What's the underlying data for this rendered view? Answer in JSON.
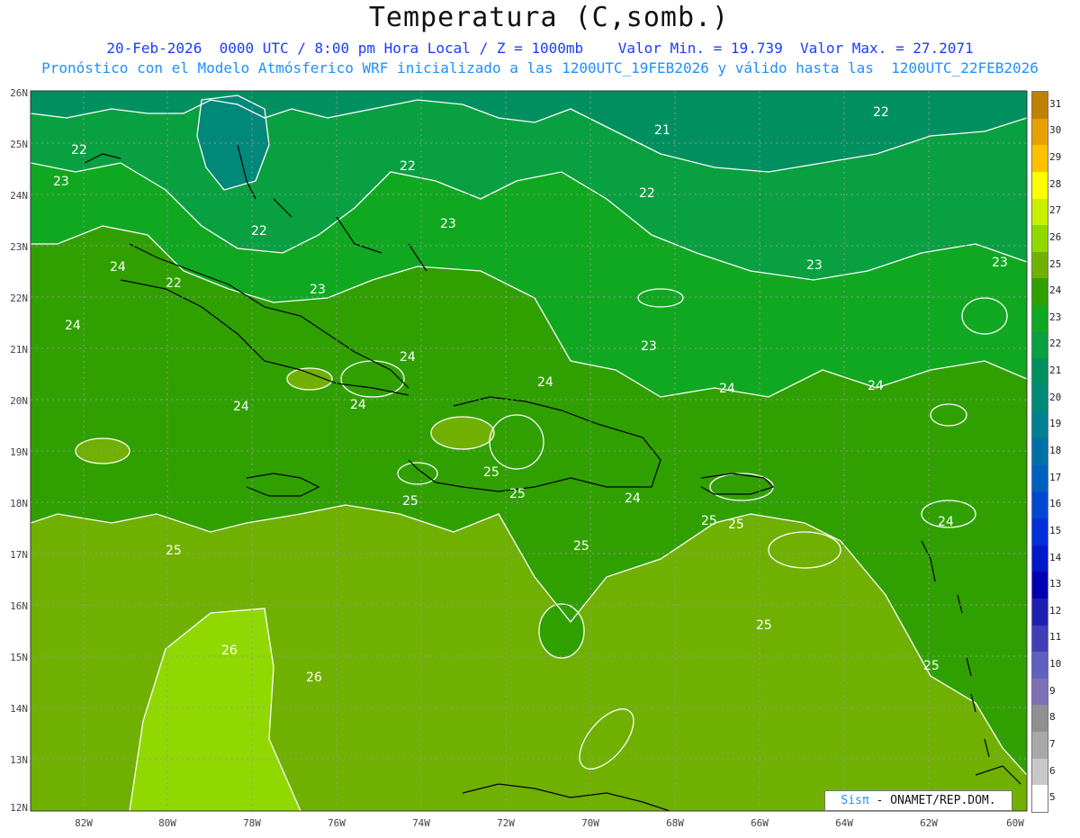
{
  "title": "Temperatura (C,somb.)",
  "subtitle1": "20-Feb-2026  0000 UTC / 8:00 pm Hora Local / Z = 1000mb    Valor Min. = 19.739  Valor Max. = 27.2071",
  "subtitle2": "Pronóstico con el Modelo Atmósferico WRF inicializado a las 1200UTC_19FEB2026 y válido hasta las  1200UTC_22FEB2026",
  "credit": {
    "brand": "Sisπ",
    "text": " - ONAMET/REP.DOM."
  },
  "lat_labels": [
    "26N",
    "25N",
    "24N",
    "23N",
    "22N",
    "21N",
    "20N",
    "19N",
    "18N",
    "17N",
    "16N",
    "15N",
    "14N",
    "13N",
    "12N"
  ],
  "lon_labels": [
    "82W",
    "80W",
    "78W",
    "76W",
    "74W",
    "72W",
    "70W",
    "68W",
    "66W",
    "64W",
    "62W",
    "60W"
  ],
  "colorbar": {
    "labels": [
      "31",
      "30",
      "29",
      "28",
      "27",
      "26",
      "25",
      "24",
      "23",
      "22",
      "21",
      "20",
      "19",
      "18",
      "17",
      "16",
      "15",
      "14",
      "13",
      "12",
      "11",
      "10",
      "9",
      "8",
      "7",
      "6",
      "5"
    ],
    "colors": [
      "#c08000",
      "#e8a000",
      "#ffc000",
      "#ffff00",
      "#c8f000",
      "#90d800",
      "#70b000",
      "#30a000",
      "#10a820",
      "#08a040",
      "#009060",
      "#008878",
      "#008090",
      "#0070a8",
      "#0060c0",
      "#0048d0",
      "#0030d8",
      "#0018c8",
      "#0000b0",
      "#2020b0",
      "#4040b8",
      "#6060c0",
      "#8070b8",
      "#909090",
      "#a8a8a8",
      "#c8c8c8",
      "#ffffff"
    ]
  },
  "contour_labels": [
    {
      "text": "22"
    },
    {
      "text": "23"
    },
    {
      "text": "22"
    },
    {
      "text": "24"
    },
    {
      "text": "22"
    },
    {
      "text": "24"
    },
    {
      "text": "22"
    },
    {
      "text": "23"
    },
    {
      "text": "23"
    },
    {
      "text": "24"
    },
    {
      "text": "24"
    },
    {
      "text": "24"
    },
    {
      "text": "21"
    },
    {
      "text": "22"
    },
    {
      "text": "22"
    },
    {
      "text": "23"
    },
    {
      "text": "23"
    },
    {
      "text": "23"
    },
    {
      "text": "24"
    },
    {
      "text": "24"
    },
    {
      "text": "24"
    },
    {
      "text": "25"
    },
    {
      "text": "25"
    },
    {
      "text": "24"
    },
    {
      "text": "25"
    },
    {
      "text": "25"
    },
    {
      "text": "25"
    },
    {
      "text": "24"
    },
    {
      "text": "25"
    },
    {
      "text": "25"
    },
    {
      "text": "26"
    },
    {
      "text": "26"
    },
    {
      "text": "25"
    },
    {
      "text": "25"
    }
  ]
}
